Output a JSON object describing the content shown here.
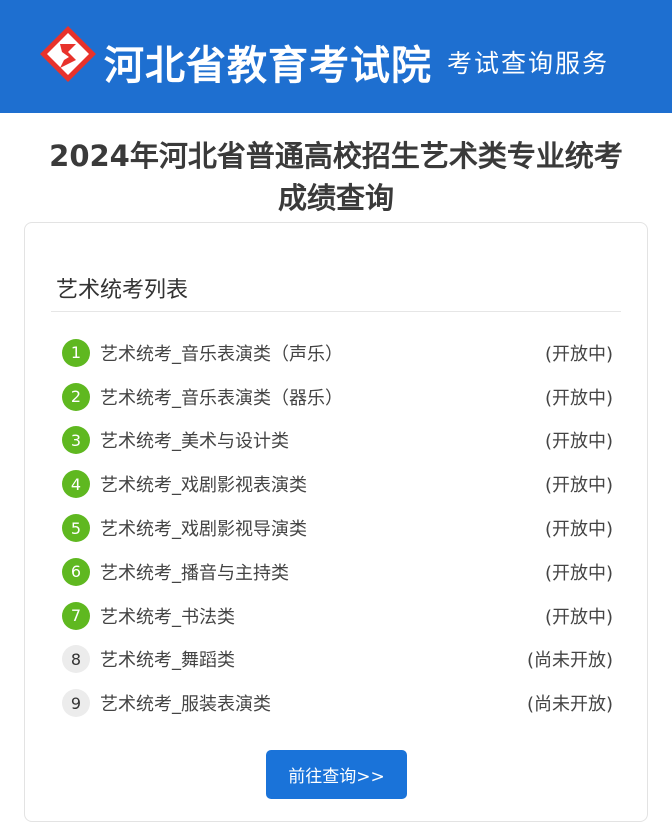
{
  "header": {
    "site_name": "河北省教育考试院",
    "service_name": "考试查询服务",
    "brand_color": "#1e6fd0",
    "logo_icon": "hebei-exam-logo-icon"
  },
  "page": {
    "title": "2024年河北省普通高校招生艺术类专业统考成绩查询"
  },
  "card": {
    "title": "艺术统考列表",
    "items": [
      {
        "num": "1",
        "label": "艺术统考_音乐表演类（声乐）",
        "status": "(开放中)",
        "open": true
      },
      {
        "num": "2",
        "label": "艺术统考_音乐表演类（器乐）",
        "status": "(开放中)",
        "open": true
      },
      {
        "num": "3",
        "label": "艺术统考_美术与设计类",
        "status": "(开放中)",
        "open": true
      },
      {
        "num": "4",
        "label": "艺术统考_戏剧影视表演类",
        "status": "(开放中)",
        "open": true
      },
      {
        "num": "5",
        "label": "艺术统考_戏剧影视导演类",
        "status": "(开放中)",
        "open": true
      },
      {
        "num": "6",
        "label": "艺术统考_播音与主持类",
        "status": "(开放中)",
        "open": true
      },
      {
        "num": "7",
        "label": "艺术统考_书法类",
        "status": "(开放中)",
        "open": true
      },
      {
        "num": "8",
        "label": "艺术统考_舞蹈类",
        "status": "(尚未开放)",
        "open": false
      },
      {
        "num": "9",
        "label": "艺术统考_服装表演类",
        "status": "(尚未开放)",
        "open": false
      }
    ],
    "open_badge_color": "#5fb820",
    "closed_badge_color": "#ececec",
    "query_button": "前往查询>>",
    "button_color": "#1a73d9"
  }
}
